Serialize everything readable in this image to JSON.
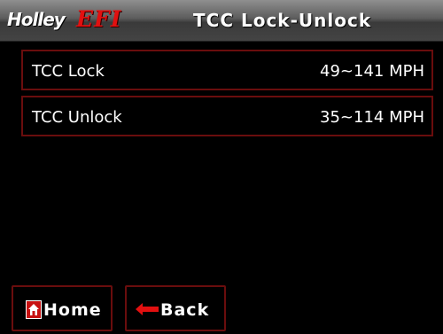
{
  "header": {
    "logo_holley": "Holley",
    "logo_efi": "EFI",
    "title": "TCC Lock-Unlock"
  },
  "rows": [
    {
      "label": "TCC Lock",
      "value": "49~141 MPH"
    },
    {
      "label": "TCC Unlock",
      "value": "35~114 MPH"
    }
  ],
  "buttons": {
    "home": {
      "label": "Home",
      "icon": "home-icon"
    },
    "back": {
      "label": "Back",
      "icon": "back-arrow-icon"
    }
  },
  "colors": {
    "accent": "#e21010",
    "border": "#6a0d0d",
    "background": "#000000"
  }
}
